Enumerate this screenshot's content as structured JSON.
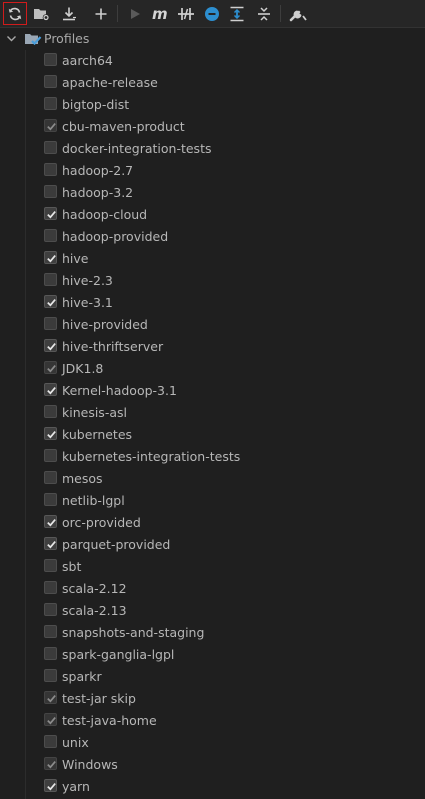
{
  "colors": {
    "accent": "#4a9edb",
    "highlight": "#d01c1c",
    "background": "#1f1f1f",
    "text": "#b7b7b7"
  },
  "toolbar": {
    "buttons": [
      {
        "icon": "reload-icon",
        "highlighted": true
      },
      {
        "icon": "generate-sources-icon"
      },
      {
        "icon": "download-icon"
      },
      {
        "icon": "plus-icon"
      },
      {
        "icon": "run-icon",
        "disabled": true
      },
      {
        "icon": "maven-goal-icon"
      },
      {
        "icon": "toggle-offline-icon"
      },
      {
        "icon": "skip-tests-icon"
      },
      {
        "icon": "show-dependencies-icon"
      },
      {
        "icon": "collapse-all-icon"
      },
      {
        "icon": "settings-wrench-icon"
      }
    ]
  },
  "profiles": {
    "label": "Profiles",
    "items": [
      {
        "label": "aarch64",
        "state": "unchecked"
      },
      {
        "label": "apache-release",
        "state": "unchecked"
      },
      {
        "label": "bigtop-dist",
        "state": "unchecked"
      },
      {
        "label": "cbu-maven-product",
        "state": "implicit"
      },
      {
        "label": "docker-integration-tests",
        "state": "unchecked"
      },
      {
        "label": "hadoop-2.7",
        "state": "unchecked"
      },
      {
        "label": "hadoop-3.2",
        "state": "unchecked"
      },
      {
        "label": "hadoop-cloud",
        "state": "checked"
      },
      {
        "label": "hadoop-provided",
        "state": "unchecked"
      },
      {
        "label": "hive",
        "state": "checked"
      },
      {
        "label": "hive-2.3",
        "state": "unchecked"
      },
      {
        "label": "hive-3.1",
        "state": "checked"
      },
      {
        "label": "hive-provided",
        "state": "unchecked"
      },
      {
        "label": "hive-thriftserver",
        "state": "checked"
      },
      {
        "label": "JDK1.8",
        "state": "implicit"
      },
      {
        "label": "Kernel-hadoop-3.1",
        "state": "checked"
      },
      {
        "label": "kinesis-asl",
        "state": "unchecked"
      },
      {
        "label": "kubernetes",
        "state": "checked"
      },
      {
        "label": "kubernetes-integration-tests",
        "state": "unchecked"
      },
      {
        "label": "mesos",
        "state": "unchecked"
      },
      {
        "label": "netlib-lgpl",
        "state": "unchecked"
      },
      {
        "label": "orc-provided",
        "state": "checked"
      },
      {
        "label": "parquet-provided",
        "state": "checked"
      },
      {
        "label": "sbt",
        "state": "unchecked"
      },
      {
        "label": "scala-2.12",
        "state": "unchecked"
      },
      {
        "label": "scala-2.13",
        "state": "unchecked"
      },
      {
        "label": "snapshots-and-staging",
        "state": "unchecked"
      },
      {
        "label": "spark-ganglia-lgpl",
        "state": "unchecked"
      },
      {
        "label": "sparkr",
        "state": "unchecked"
      },
      {
        "label": "test-jar skip",
        "state": "implicit"
      },
      {
        "label": "test-java-home",
        "state": "implicit"
      },
      {
        "label": "unix",
        "state": "unchecked"
      },
      {
        "label": "Windows",
        "state": "implicit"
      },
      {
        "label": "yarn",
        "state": "checked"
      }
    ]
  }
}
